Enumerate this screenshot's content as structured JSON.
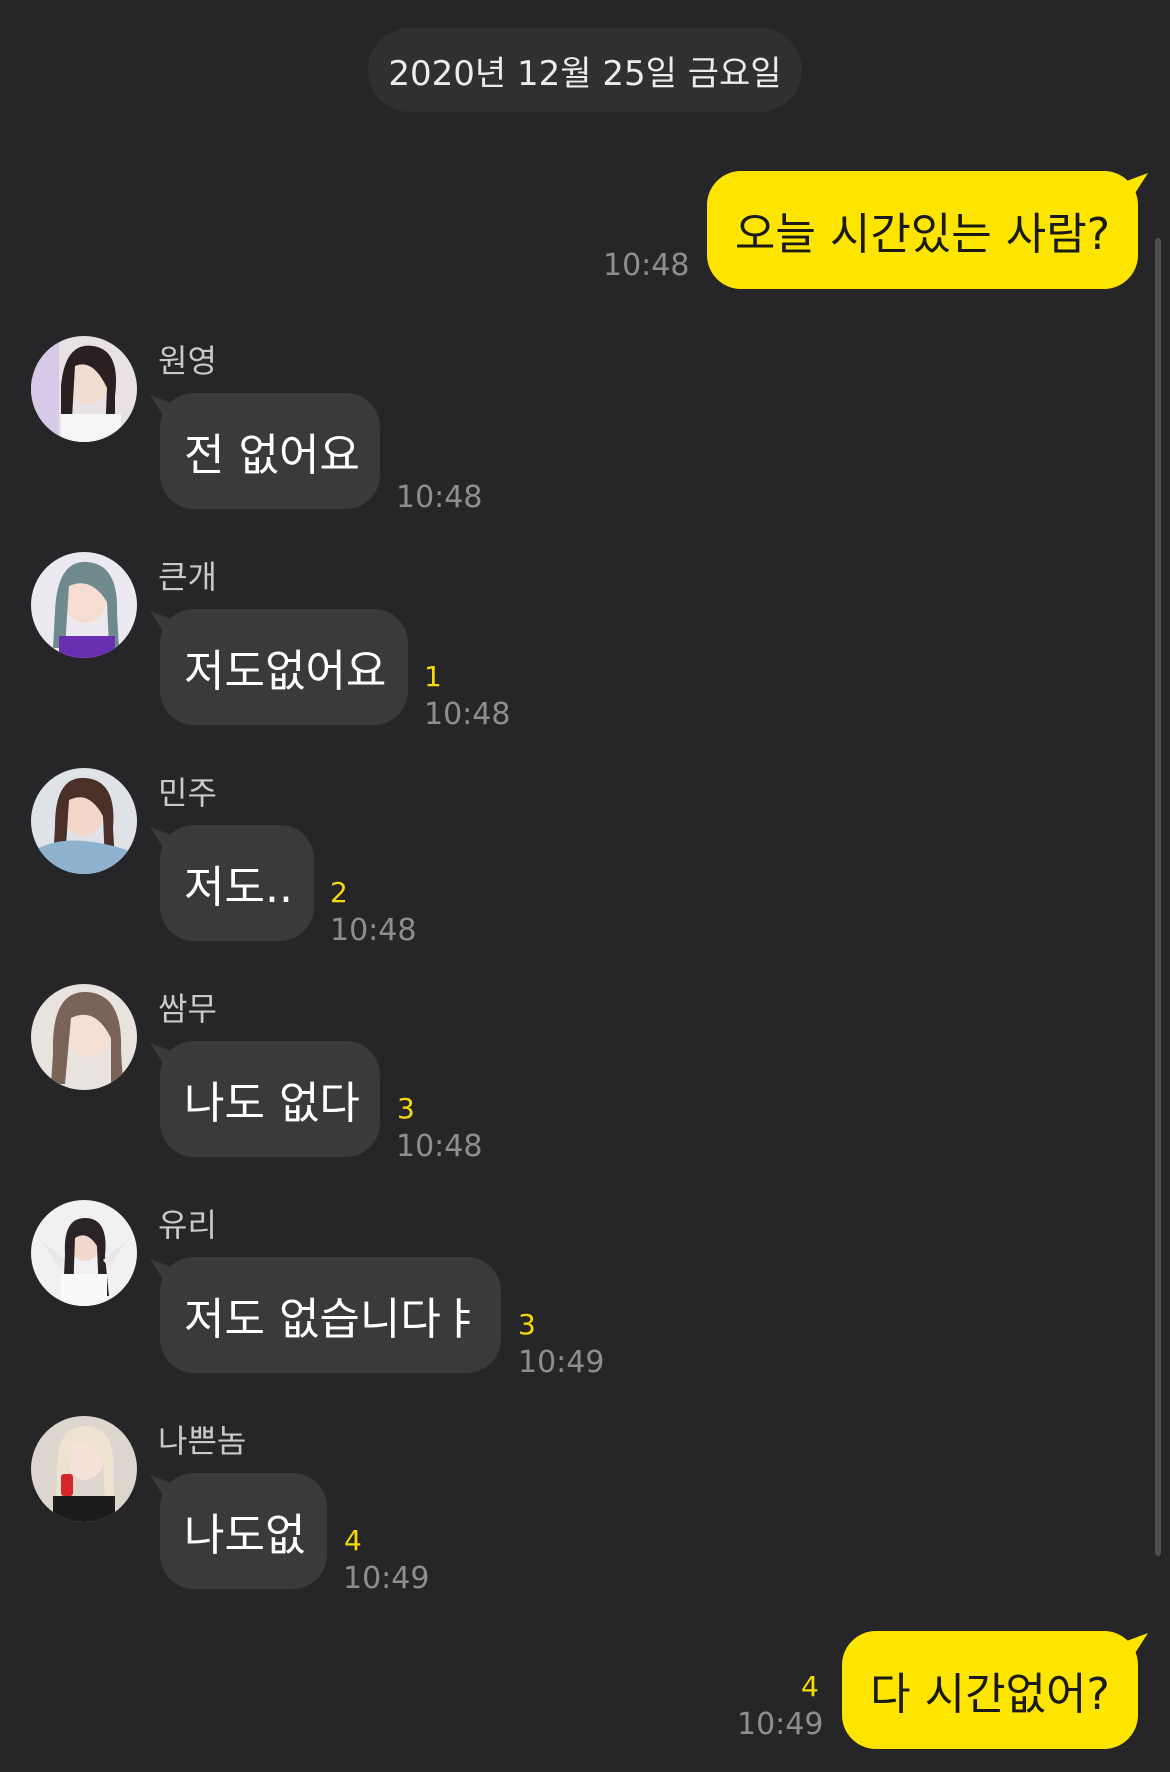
{
  "date_divider": "2020년 12월 25일 금요일",
  "messages": [
    {
      "from_me": true,
      "text": "오늘 시간있는 사람?",
      "time": "10:48",
      "unread": ""
    },
    {
      "from_me": false,
      "sender": "원영",
      "text": "전 없어요",
      "time": "10:48",
      "unread": ""
    },
    {
      "from_me": false,
      "sender": "큰개",
      "text": "저도없어요",
      "time": "10:48",
      "unread": "1"
    },
    {
      "from_me": false,
      "sender": "민주",
      "text": "저도..",
      "time": "10:48",
      "unread": "2"
    },
    {
      "from_me": false,
      "sender": "쌈무",
      "text": "나도 없다",
      "time": "10:48",
      "unread": "3"
    },
    {
      "from_me": false,
      "sender": "유리",
      "text": "저도 없습니다ㅑ",
      "time": "10:49",
      "unread": "3"
    },
    {
      "from_me": false,
      "sender": "나쁜놈",
      "text": "나도없",
      "time": "10:49",
      "unread": "4"
    },
    {
      "from_me": true,
      "text": "다 시간없어?",
      "time": "10:49",
      "unread": "4"
    }
  ],
  "colors": {
    "background": "#262628",
    "incoming_bubble": "#3a3a3c",
    "outgoing_bubble": "#fee500",
    "unread_count": "#f5d90a",
    "timestamp": "#8e8e90"
  }
}
